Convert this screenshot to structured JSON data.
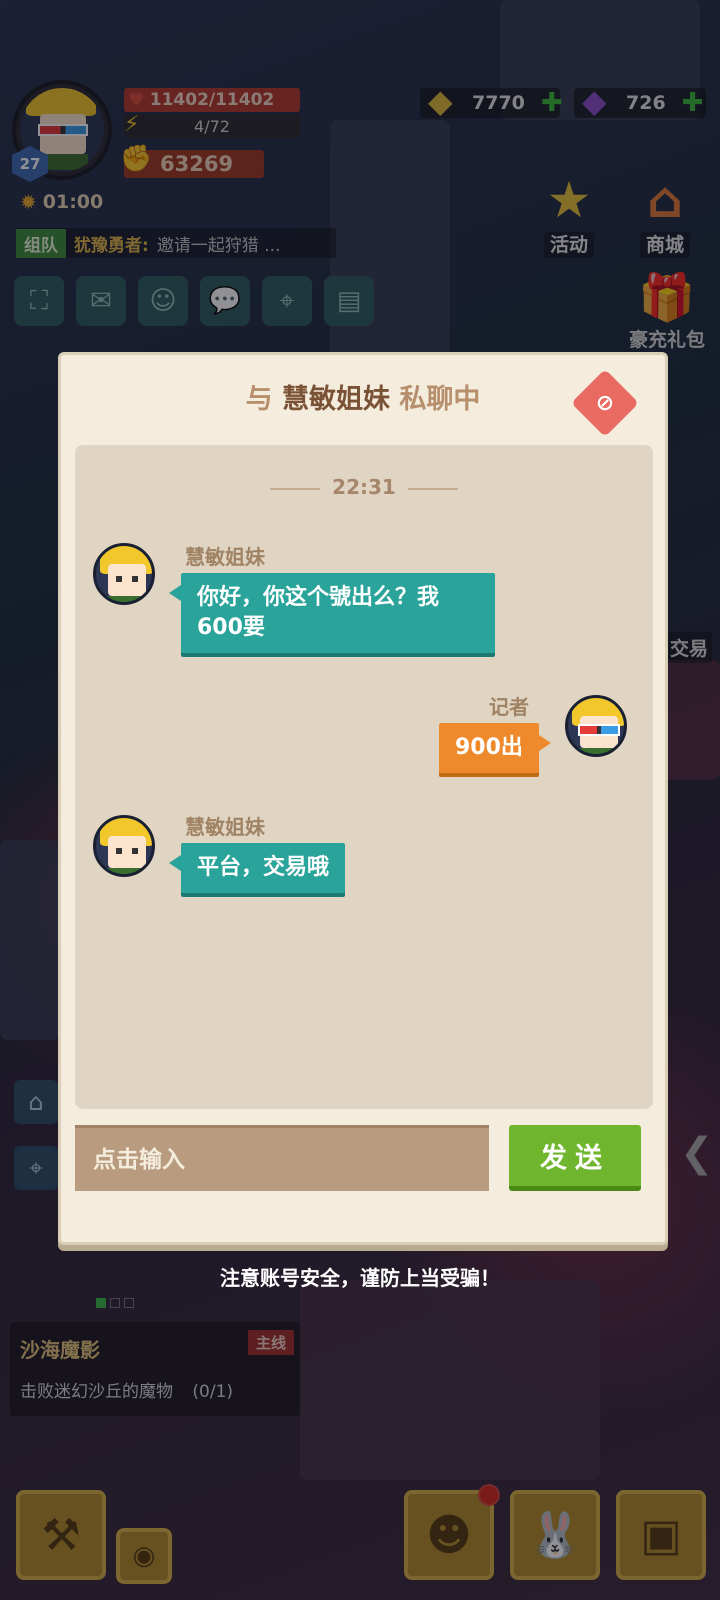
{
  "hud": {
    "level": "27",
    "hp": "11402/11402",
    "energy": "4/72",
    "power": "63269",
    "timer": "01:00",
    "team": {
      "tag": "组队",
      "name": "犹豫勇者:",
      "message": "邀请一起狩猎 ..."
    },
    "gold": "7770",
    "gems": "726",
    "activity_label": "活动",
    "shop_label": "商城",
    "gift_label": "豪充礼包",
    "trade_side_label": "交易"
  },
  "quest": {
    "title": "沙海魔影",
    "tag": "主线",
    "description": "击败迷幻沙丘的魔物",
    "progress": "(0/1)"
  },
  "dialog": {
    "title_prefix": "与",
    "title_name": "慧敏姐妹",
    "title_suffix": "私聊中",
    "timestamp": "22:31",
    "messages": [
      {
        "sender": "慧敏姐妹",
        "text": "你好，你这个號出么？我600要",
        "side": "left"
      },
      {
        "sender": "记者",
        "text": "900出",
        "side": "right"
      },
      {
        "sender": "慧敏姐妹",
        "text": "平台，交易哦",
        "side": "left"
      }
    ],
    "input_placeholder": "点击输入",
    "send_label": "发送"
  },
  "warning": "注意账号安全，谨防上当受骗！",
  "icons": {
    "close": "chat-block-icon",
    "gold": "gold-gem-icon",
    "gem": "purple-gem-icon"
  }
}
